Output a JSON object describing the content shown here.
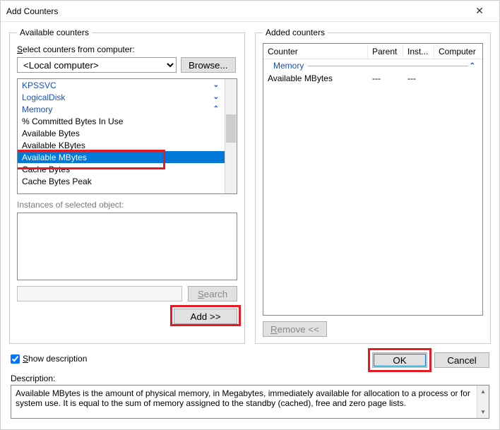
{
  "window": {
    "title": "Add Counters",
    "close_glyph": "✕"
  },
  "left": {
    "legend": "Available counters",
    "select_label_pre": "S",
    "select_label_rest": "elect counters from computer:",
    "computer": "<Local computer>",
    "browse": "Browse...",
    "tree": [
      {
        "label": "KPSSVC",
        "type": "header",
        "state": "collapsed"
      },
      {
        "label": "LogicalDisk",
        "type": "header",
        "state": "collapsed"
      },
      {
        "label": "Memory",
        "type": "header",
        "state": "expanded"
      },
      {
        "label": "% Committed Bytes In Use",
        "type": "child"
      },
      {
        "label": "Available Bytes",
        "type": "child"
      },
      {
        "label": "Available KBytes",
        "type": "child"
      },
      {
        "label": "Available MBytes",
        "type": "child",
        "selected": true
      },
      {
        "label": "Cache Bytes",
        "type": "child"
      },
      {
        "label": "Cache Bytes Peak",
        "type": "child"
      }
    ],
    "instances_label": "Instances of selected object:",
    "search_label": "Search",
    "add_label": "Add >>"
  },
  "right": {
    "legend": "Added counters",
    "cols": {
      "counter": "Counter",
      "parent": "Parent",
      "inst": "Inst...",
      "computer": "Computer"
    },
    "group": "Memory",
    "row": {
      "counter": "Available MBytes",
      "parent": "---",
      "inst": "---",
      "computer": ""
    },
    "remove_pre": "R",
    "remove_rest": "emove <<"
  },
  "footer": {
    "showdesc_pre": "S",
    "showdesc_rest": "how description",
    "ok": "OK",
    "cancel": "Cancel",
    "desc_label": "Description:",
    "desc_text": "Available MBytes is the amount of physical memory, in Megabytes, immediately available for allocation to a process or for system use. It is equal to the sum of memory assigned to the standby (cached), free and zero page lists."
  }
}
